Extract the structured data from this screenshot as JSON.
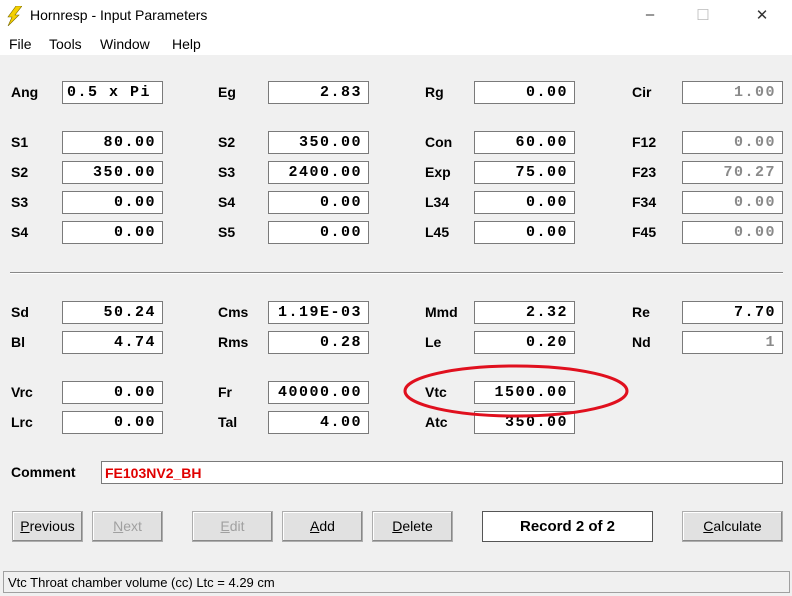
{
  "window": {
    "title": "Hornresp - Input Parameters",
    "controls": [
      "–",
      "☐",
      "✕"
    ]
  },
  "menu": [
    "File",
    "Tools",
    "Window",
    "Help"
  ],
  "fields": [
    {
      "label": "Ang",
      "value": "0.5 x Pi",
      "col": 0,
      "row": 0,
      "align": "left"
    },
    {
      "label": "Eg",
      "value": "2.83",
      "col": 1,
      "row": 0
    },
    {
      "label": "Rg",
      "value": "0.00",
      "col": 2,
      "row": 0
    },
    {
      "label": "Cir",
      "value": "1.00",
      "col": 3,
      "row": 0,
      "readonly": true
    },
    {
      "label": "S1",
      "value": "80.00",
      "col": 0,
      "row": 1
    },
    {
      "label": "S2",
      "value": "350.00",
      "col": 1,
      "row": 1
    },
    {
      "label": "Con",
      "value": "60.00",
      "col": 2,
      "row": 1
    },
    {
      "label": "F12",
      "value": "0.00",
      "col": 3,
      "row": 1,
      "readonly": true
    },
    {
      "label": "S2",
      "value": "350.00",
      "col": 0,
      "row": 2
    },
    {
      "label": "S3",
      "value": "2400.00",
      "col": 1,
      "row": 2
    },
    {
      "label": "Exp",
      "value": "75.00",
      "col": 2,
      "row": 2
    },
    {
      "label": "F23",
      "value": "70.27",
      "col": 3,
      "row": 2,
      "readonly": true
    },
    {
      "label": "S3",
      "value": "0.00",
      "col": 0,
      "row": 3
    },
    {
      "label": "S4",
      "value": "0.00",
      "col": 1,
      "row": 3
    },
    {
      "label": "L34",
      "value": "0.00",
      "col": 2,
      "row": 3
    },
    {
      "label": "F34",
      "value": "0.00",
      "col": 3,
      "row": 3,
      "readonly": true
    },
    {
      "label": "S4",
      "value": "0.00",
      "col": 0,
      "row": 4
    },
    {
      "label": "S5",
      "value": "0.00",
      "col": 1,
      "row": 4
    },
    {
      "label": "L45",
      "value": "0.00",
      "col": 2,
      "row": 4
    },
    {
      "label": "F45",
      "value": "0.00",
      "col": 3,
      "row": 4,
      "readonly": true
    },
    {
      "label": "Sd",
      "value": "50.24",
      "col": 0,
      "row": 5
    },
    {
      "label": "Cms",
      "value": "1.19E-03",
      "col": 1,
      "row": 5
    },
    {
      "label": "Mmd",
      "value": "2.32",
      "col": 2,
      "row": 5
    },
    {
      "label": "Re",
      "value": "7.70",
      "col": 3,
      "row": 5
    },
    {
      "label": "Bl",
      "value": "4.74",
      "col": 0,
      "row": 6
    },
    {
      "label": "Rms",
      "value": "0.28",
      "col": 1,
      "row": 6
    },
    {
      "label": "Le",
      "value": "0.20",
      "col": 2,
      "row": 6
    },
    {
      "label": "Nd",
      "value": "1",
      "col": 3,
      "row": 6,
      "readonly": true
    },
    {
      "label": "Vrc",
      "value": "0.00",
      "col": 0,
      "row": 7
    },
    {
      "label": "Fr",
      "value": "40000.00",
      "col": 1,
      "row": 7
    },
    {
      "label": "Vtc",
      "value": "1500.00",
      "col": 2,
      "row": 7,
      "highlighted": true
    },
    {
      "label": "Lrc",
      "value": "0.00",
      "col": 0,
      "row": 8
    },
    {
      "label": "Tal",
      "value": "4.00",
      "col": 1,
      "row": 8
    },
    {
      "label": "Atc",
      "value": "350.00",
      "col": 2,
      "row": 8
    }
  ],
  "comment": {
    "label": "Comment",
    "value": "FE103NV2_BH"
  },
  "buttons": [
    {
      "label": "Previous",
      "enabled": true
    },
    {
      "label": "Next",
      "enabled": false
    },
    {
      "label": "Edit",
      "enabled": false
    },
    {
      "label": "Add",
      "enabled": true
    },
    {
      "label": "Delete",
      "enabled": true
    },
    {
      "label": "Calculate",
      "enabled": true
    }
  ],
  "record": "Record 2 of 2",
  "status": "Vtc   Throat chamber volume  (cc)   Ltc = 4.29 cm",
  "colors": {
    "highlight_ellipse": "#e0101e",
    "comment_text": "#e00000"
  }
}
